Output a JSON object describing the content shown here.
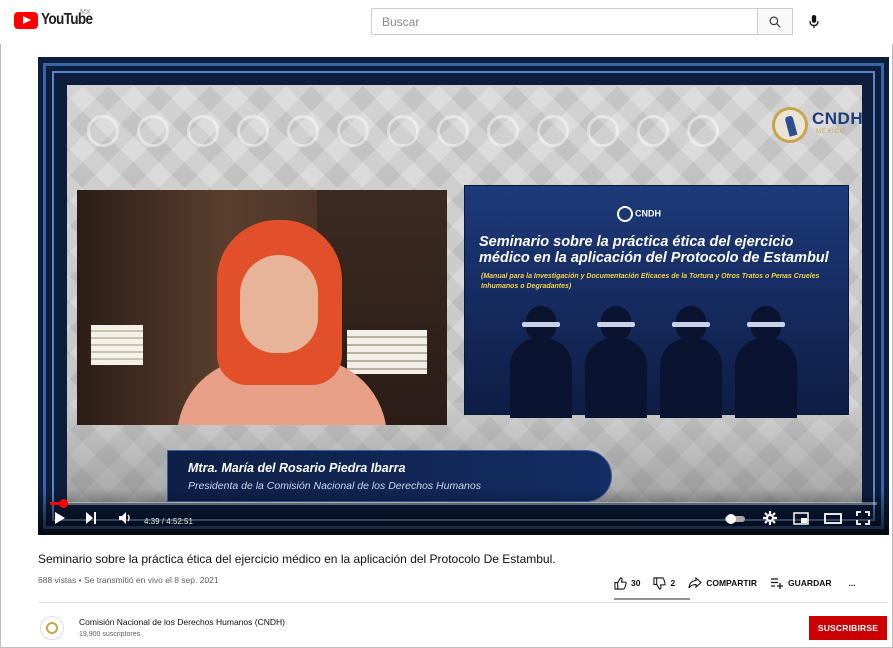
{
  "header": {
    "logo_text": "YouTube",
    "region": "MX",
    "search_placeholder": "Buscar"
  },
  "video": {
    "slide": {
      "logo": "CNDH",
      "title": "Seminario sobre la práctica ética del ejercicio médico en la aplicación del Protocolo de Estambul",
      "subtitle": "(Manual para la Investigación y Documentación Eficaces de la Tortura y Otros Tratos o Penas Crueles Inhumanos o Degradantes)"
    },
    "corner_logo": "CNDH",
    "corner_logo_sub": "MÉXICO",
    "lower_third": {
      "name": "Mtra. María del Rosario Piedra Ibarra",
      "role": "Presidenta de la Comisión Nacional de los Derechos Humanos"
    },
    "player": {
      "time": "4:39 / 4:52:51",
      "progress": 0.016
    }
  },
  "info": {
    "title": "Seminario sobre la práctica ética del ejercicio médico en la aplicación del Protocolo De Estambul.",
    "meta": "688 vistas • Se transmitió en vivo el 8 sep. 2021",
    "likes": "30",
    "dislikes": "2",
    "share_label": "COMPARTIR",
    "save_label": "GUARDAR",
    "more_label": "..."
  },
  "channel": {
    "name": "Comisión Nacional de los Derechos Humanos (CNDH)",
    "subscribers": "19,900 suscriptores",
    "subscribe_label": "SUSCRIBIRSE"
  },
  "colors": {
    "brand_red": "#ff0000",
    "subscribe_red": "#cc0000"
  }
}
